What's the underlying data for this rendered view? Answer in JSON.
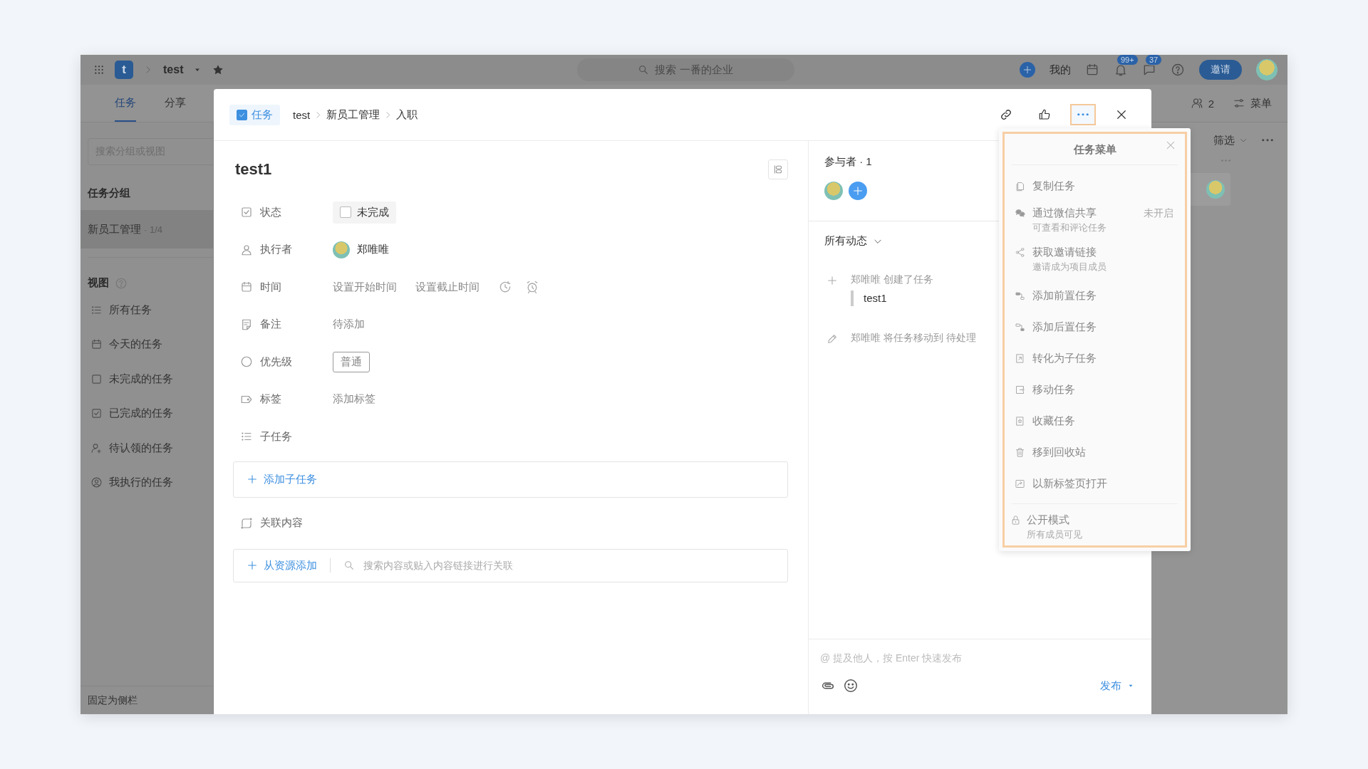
{
  "topbar": {
    "logo_letter": "t",
    "project": "test",
    "search_placeholder": "搜索 一番的企业",
    "mine": "我的",
    "notifications": "99+",
    "messages": "37",
    "invite": "邀请"
  },
  "tabs": [
    {
      "label": "任务",
      "selected": true
    },
    {
      "label": "分享",
      "selected": false
    }
  ],
  "toolbar_right": {
    "member_count": "2",
    "menu": "菜单",
    "filter": "筛选"
  },
  "sidebar": {
    "search_placeholder": "搜索分组或视图",
    "groups_title": "任务分组",
    "groups": [
      {
        "label": "新员工管理",
        "count": "· 1/4",
        "selected": true
      }
    ],
    "views_title": "视图",
    "views": [
      {
        "label": "所有任务"
      },
      {
        "label": "今天的任务"
      },
      {
        "label": "未完成的任务"
      },
      {
        "label": "已完成的任务"
      },
      {
        "label": "待认领的任务"
      },
      {
        "label": "我执行的任务"
      }
    ],
    "pin": "固定为侧栏"
  },
  "task": {
    "type_tag": "任务",
    "breadcrumb": [
      "test",
      "新员工管理",
      "入职"
    ],
    "more_highlighted": true,
    "title": "test1",
    "fields": [
      {
        "kind": "status",
        "label": "状态",
        "value": "未完成",
        "checked": false
      },
      {
        "kind": "assignee",
        "label": "执行者",
        "value": "郑唯唯"
      },
      {
        "kind": "time",
        "label": "时间",
        "start": "设置开始时间",
        "due": "设置截止时间"
      },
      {
        "kind": "note",
        "label": "备注",
        "value": "待添加"
      },
      {
        "kind": "priority",
        "label": "优先级",
        "value": "普通"
      },
      {
        "kind": "tags",
        "label": "标签",
        "value": "添加标签"
      },
      {
        "kind": "subtasks",
        "label": "子任务"
      }
    ],
    "add_subtask": "添加子任务",
    "related_label": "关联内容",
    "add_resource": "从资源添加",
    "resource_placeholder": "搜索内容或贴入内容链接进行关联"
  },
  "participants": {
    "title": "参与者 · 1"
  },
  "activity": {
    "filter": "所有动态",
    "items": [
      {
        "kind": "create",
        "text": "郑唯唯 创建了任务",
        "quote": "test1"
      },
      {
        "kind": "edit",
        "text": "郑唯唯 将任务移动到 待处理"
      }
    ]
  },
  "composer": {
    "placeholder": "@ 提及他人，按 Enter 快速发布",
    "submit": "发布"
  },
  "task_menu": {
    "title": "任务菜单",
    "highlighted": true,
    "items": [
      {
        "label": "复制任务"
      },
      {
        "label": "通过微信共享",
        "hint": "可查看和评论任务",
        "status": "未开启"
      },
      {
        "label": "获取邀请链接",
        "hint": "邀请成为项目成员"
      },
      {
        "label": "添加前置任务"
      },
      {
        "label": "添加后置任务"
      },
      {
        "label": "转化为子任务"
      },
      {
        "label": "移动任务"
      },
      {
        "label": "收藏任务"
      },
      {
        "label": "移到回收站"
      },
      {
        "label": "以新标签页打开"
      }
    ],
    "footer": {
      "label": "公开模式",
      "hint": "所有成员可见"
    }
  }
}
